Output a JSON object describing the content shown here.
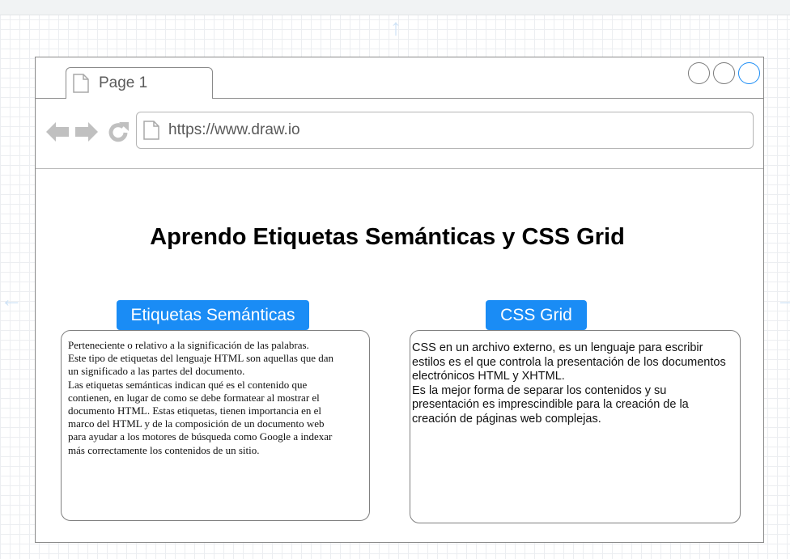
{
  "browser": {
    "tab_label": "Page 1",
    "url": "https://www.draw.io",
    "window_controls": [
      "minimize",
      "maximize",
      "close"
    ],
    "nav_icons": [
      "back-arrow-icon",
      "forward-arrow-icon",
      "refresh-icon"
    ]
  },
  "main": {
    "title": "Aprendo Etiquetas Semánticas y CSS Grid",
    "sections": [
      {
        "label": "Etiquetas Semánticas",
        "lines": [
          "Perteneciente o relativo a la significación de las palabras.",
          " Este tipo de etiquetas del lenguaje HTML son aquellas que dan",
          "un significado a las partes del documento.",
          "Las etiquetas semánticas indican qué es el contenido que",
          "contienen, en lugar de como se debe formatear al mostrar el",
          "documento HTML. Estas   etiquetas, tienen importancia en el",
          " marco del HTML y de la composición de un documento web",
          " para ayudar a los motores de búsqueda como Google a indexar",
          " más correctamente los contenidos de un sitio."
        ]
      },
      {
        "label": "CSS Grid",
        "lines": [
          "CSS en un archivo externo, es un lenguaje para escribir",
          "estilos es el que controla la presentación de los documentos",
          "electrónicos HTML y XHTML.",
          "Es la mejor forma de separar los contenidos y su",
          "presentación es imprescindible para la creación de la",
          "creación de páginas web complejas."
        ]
      }
    ]
  },
  "colors": {
    "accent": "#1a8cf5",
    "close_button": "#1a8cf5",
    "window_border": "#8a8a8a",
    "icon_gray": "#c0c0c0",
    "grid_line": "#eceef1"
  }
}
